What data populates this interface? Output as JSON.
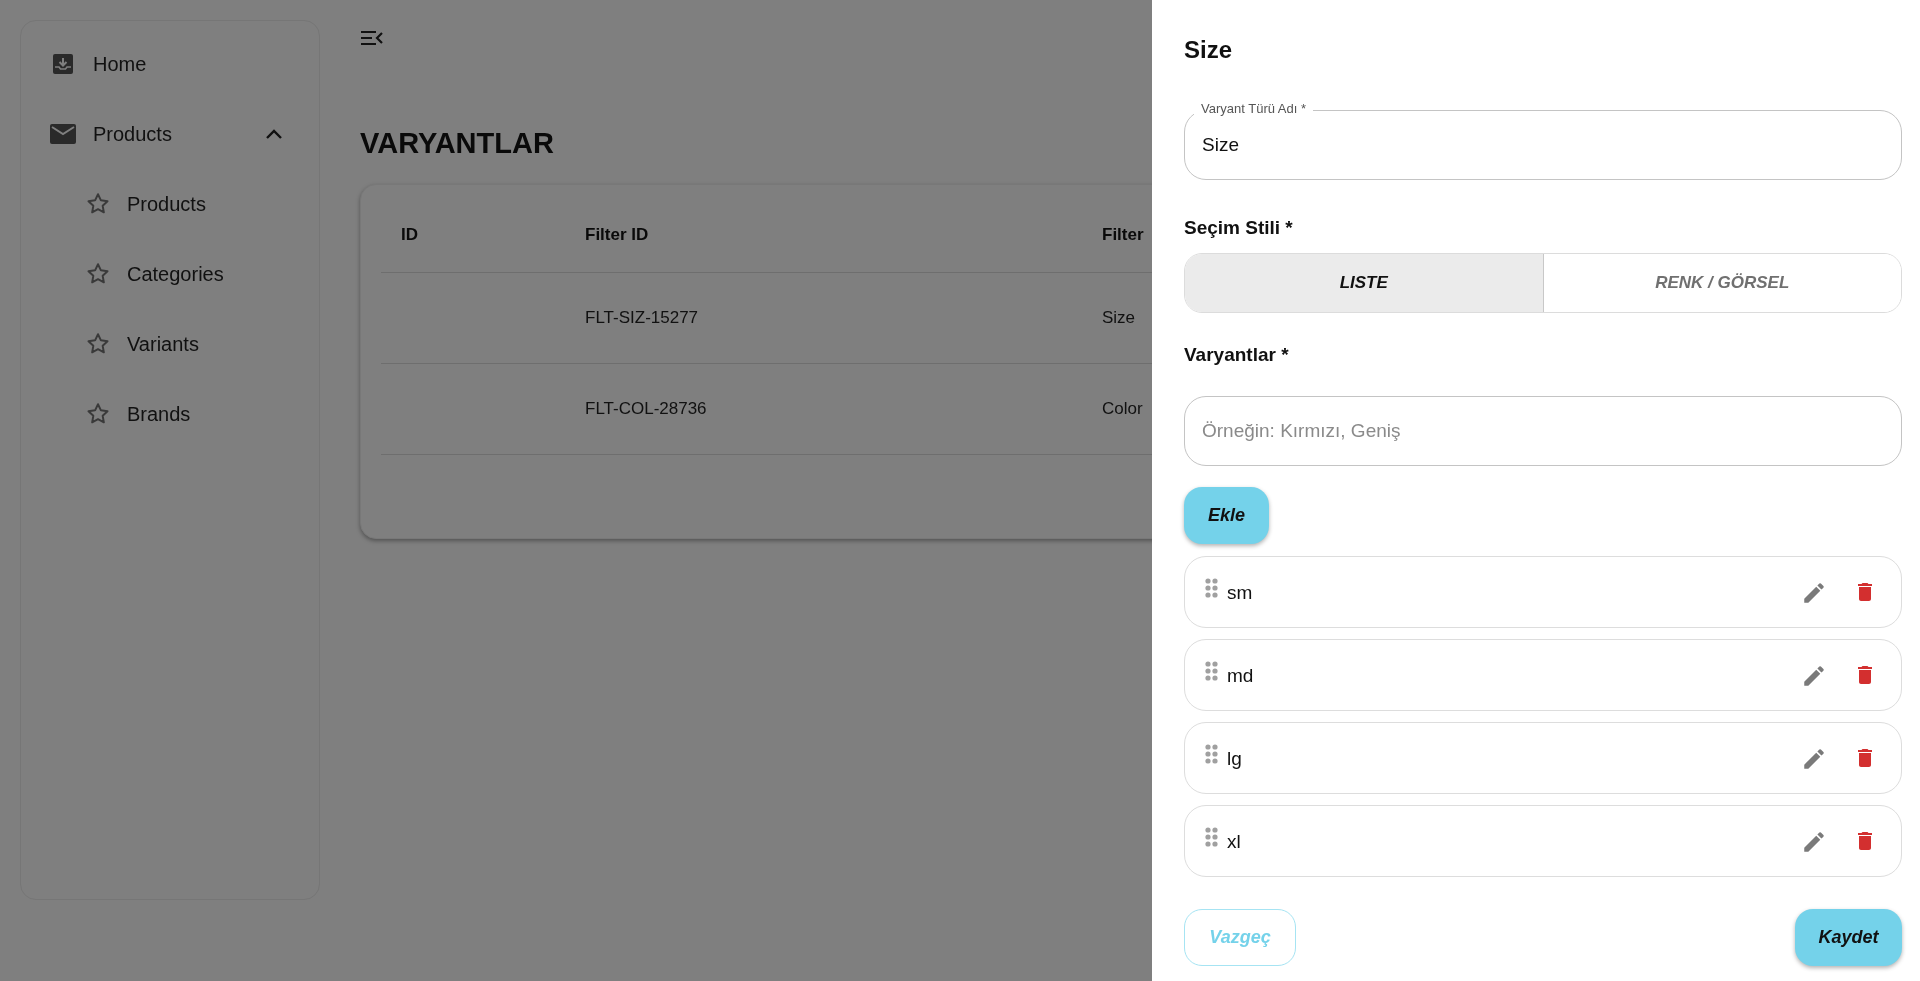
{
  "sidebar": {
    "items": [
      {
        "label": "Home",
        "kind": "link"
      },
      {
        "label": "Products",
        "kind": "group",
        "expanded": true,
        "children": [
          {
            "label": "Products"
          },
          {
            "label": "Categories"
          },
          {
            "label": "Variants"
          },
          {
            "label": "Brands"
          }
        ]
      }
    ]
  },
  "page": {
    "title": "VARYANTLAR",
    "table": {
      "columns": [
        "ID",
        "Filter ID",
        "Filter"
      ],
      "rows": [
        [
          "",
          "FLT-SIZ-15277",
          "Size"
        ],
        [
          "",
          "FLT-COL-28736",
          "Color"
        ]
      ]
    }
  },
  "drawer": {
    "title": "Size",
    "name_field": {
      "label": "Varyant Türü Adı *",
      "value": "Size"
    },
    "style_label": "Seçim Stili *",
    "style_options": [
      {
        "label": "LISTE",
        "selected": true
      },
      {
        "label": "RENK / GÖRSEL",
        "selected": false
      }
    ],
    "variants_label": "Varyantlar *",
    "variant_input": {
      "placeholder": "Örneğin: Kırmızı, Geniş"
    },
    "add_button": "Ekle",
    "variants": [
      {
        "label": "sm"
      },
      {
        "label": "md"
      },
      {
        "label": "lg"
      },
      {
        "label": "xl"
      }
    ],
    "cancel_button": "Vazgeç",
    "save_button": "Kaydet"
  }
}
